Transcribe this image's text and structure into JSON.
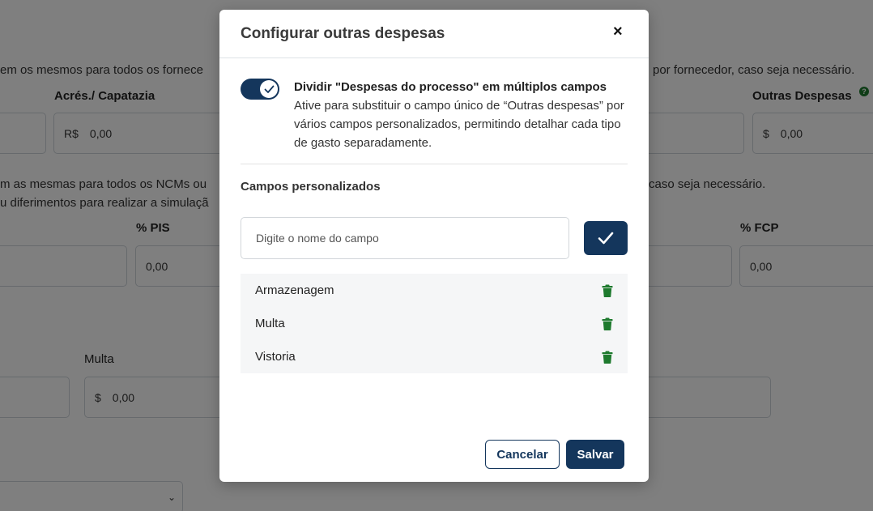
{
  "background": {
    "supplier_note_left": "em os mesmos para todos os fornece",
    "supplier_note_right": "por fornecedor, caso seja necessário.",
    "ncm_note_left_1": "m as mesmas para todos os NCMs ou",
    "ncm_note_left_2": "u diferimentos para realizar a simulaçã",
    "ncm_note_right": "caso seja necessário.",
    "label_acres": "Acrés./ Capatazia",
    "label_outras": "Outras Despesas",
    "label_pis": "% PIS",
    "label_fcp": "% FCP",
    "label_multa": "Multa",
    "prefix_brl": "R$",
    "prefix_usd": "$",
    "value_zero": "0,00",
    "help_glyph": "?",
    "select_chevron": "⌄"
  },
  "modal": {
    "title": "Configurar outras despesas",
    "close_glyph": "×",
    "toggle": {
      "on": true,
      "title": "Dividir \"Despesas do processo\" em múltiplos campos",
      "description": "Ative para substituir o campo único de “Outras despesas” por vários campos personalizados, permitindo detalhar cada tipo de gasto separadamente."
    },
    "section_title": "Campos personalizados",
    "field_input": {
      "value": "",
      "placeholder": "Digite o nome do campo"
    },
    "items": [
      {
        "label": "Armazenagem"
      },
      {
        "label": "Multa"
      },
      {
        "label": "Vistoria"
      }
    ],
    "cancel_label": "Cancelar",
    "save_label": "Salvar"
  },
  "colors": {
    "primary": "#14365c",
    "trash": "#1e7a2e",
    "overlay": "rgba(0,0,0,0.5)"
  },
  "icons": {
    "close": "close-icon",
    "toggle_check": "check-icon",
    "confirm": "check-icon",
    "delete": "trash-icon",
    "help": "help-icon",
    "select": "chevron-down-icon"
  }
}
